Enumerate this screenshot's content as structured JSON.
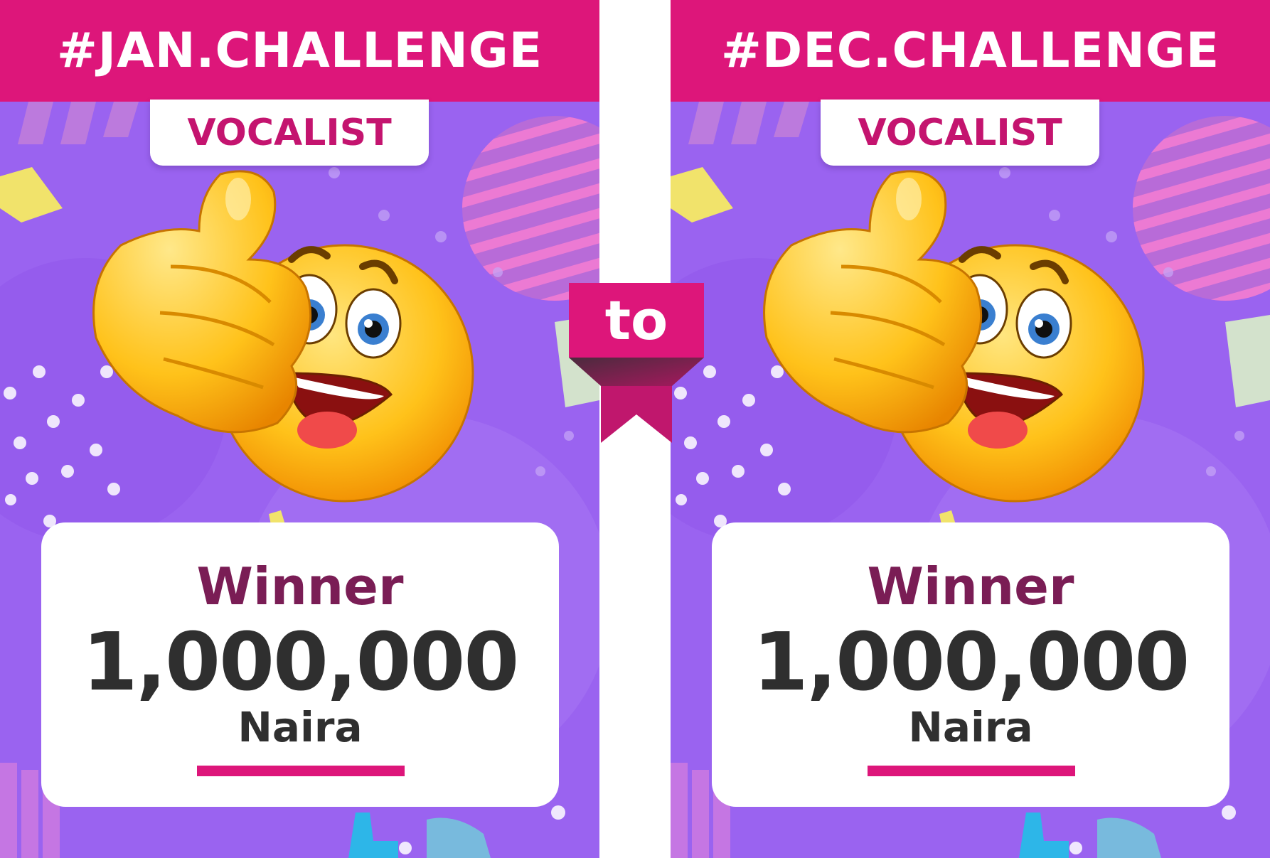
{
  "colors": {
    "accent": "#dd167a",
    "background": "#9a63f0",
    "winner_text": "#7a1d55",
    "amount_text": "#2f2f2f",
    "card": "#ffffff"
  },
  "panels": [
    {
      "challenge": "#JAN.CHALLENGE",
      "category": "VOCALIST",
      "emoji_icon": "thumbs-up-smiley-icon",
      "title": "Winner",
      "amount": "1,000,000",
      "currency": "Naira"
    },
    {
      "challenge": "#DEC.CHALLENGE",
      "category": "VOCALIST",
      "emoji_icon": "thumbs-up-smiley-icon",
      "title": "Winner",
      "amount": "1,000,000",
      "currency": "Naira"
    }
  ],
  "connector": {
    "label": "to"
  }
}
